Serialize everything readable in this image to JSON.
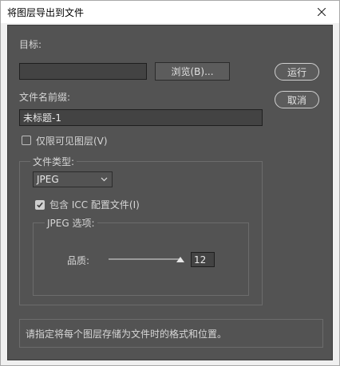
{
  "window": {
    "title": "将图层导出到文件"
  },
  "target": {
    "label": "目标:",
    "value": "",
    "browse_label": "浏览(B)..."
  },
  "actions": {
    "run_label": "运行",
    "cancel_label": "取消"
  },
  "prefix": {
    "label": "文件名前缀:",
    "value": "未标题-1"
  },
  "visible_only": {
    "label": "仅限可见图层(V)",
    "checked": false
  },
  "file_type": {
    "group_label": "文件类型:",
    "selected": "JPEG",
    "include_icc_label": "包含 ICC 配置文件(I)",
    "include_icc_checked": true
  },
  "jpeg_options": {
    "group_label": "JPEG 选项:",
    "quality_label": "品质:",
    "quality_value": "12",
    "quality_fraction": 1.0
  },
  "description": "请指定将每个图层存储为文件时的格式和位置。",
  "colors": {
    "panel": "#535353",
    "text": "#d6d6d6",
    "field": "#434343"
  }
}
